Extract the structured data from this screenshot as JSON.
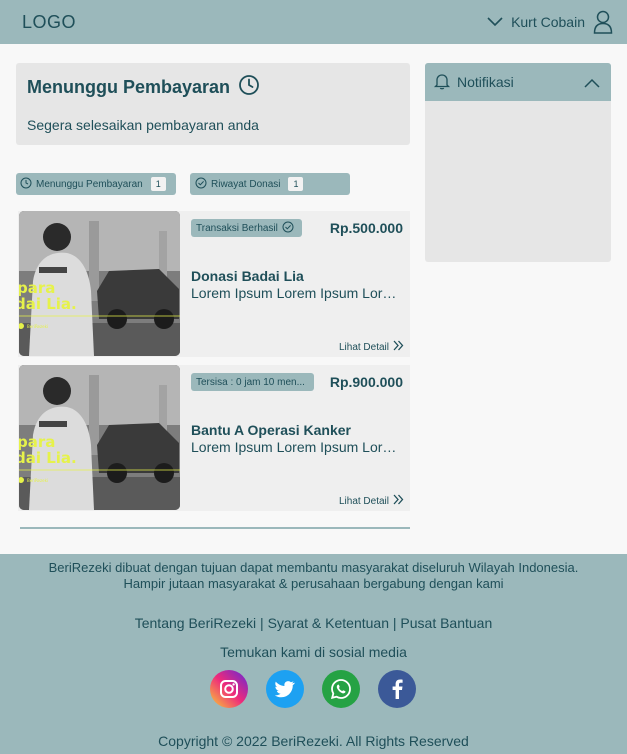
{
  "header": {
    "logo": "LOGO",
    "user_name": "Kurt Cobain"
  },
  "pending": {
    "title": "Menunggu Pembayaran",
    "subtitle": "Segera selesaikan pembayaran anda"
  },
  "tabs": [
    {
      "label": "Menunggu Pembayaran",
      "count": "1"
    },
    {
      "label": "Riwayat Donasi",
      "count": "1"
    }
  ],
  "donations": [
    {
      "status": "Transaksi Berhasil",
      "amount": "Rp.500.000",
      "title": "Donasi Badai Lia",
      "description": "Lorem Ipsum Lorem Ipsum Lorem Ipsum",
      "detail_label": "Lihat Detail",
      "image_text": "para\ndai Lia."
    },
    {
      "status": "Tersisa : 0 jam 10 men...",
      "amount": "Rp.900.000",
      "title": "Bantu A Operasi Kanker",
      "description": "Lorem Ipsum Lorem Ipsum Lorem Ipsum",
      "detail_label": "Lihat Detail",
      "image_text": "para\ndai Lia."
    }
  ],
  "notifications": {
    "title": "Notifikasi"
  },
  "footer": {
    "about_line1": "BeriRezeki dibuat dengan tujuan dapat membantu masyarakat diseluruh Wilayah Indonesia.",
    "about_line2": "Hampir jutaan masyarakat & perusahaan bergabung dengan kami",
    "links": [
      "Tentang BeriRezeki",
      "Syarat & Ketentuan",
      "Pusat Bantuan"
    ],
    "link_separator": "|",
    "social_label": "Temukan kami di sosial media",
    "socials": [
      {
        "name": "instagram-icon",
        "color": "#d6249f"
      },
      {
        "name": "twitter-icon",
        "color": "#1da1f2"
      },
      {
        "name": "whatsapp-icon",
        "color": "#25a244"
      },
      {
        "name": "facebook-icon",
        "color": "#3b5998"
      }
    ],
    "copyright": "Copyright © 2022 BeriRezeki. All Rights Reserved"
  },
  "colors": {
    "header_bg": "#9bb8bb",
    "text_primary": "#1f4f59",
    "card_bg": "#e6e6e6",
    "accent_yellow": "#e6f24a"
  }
}
